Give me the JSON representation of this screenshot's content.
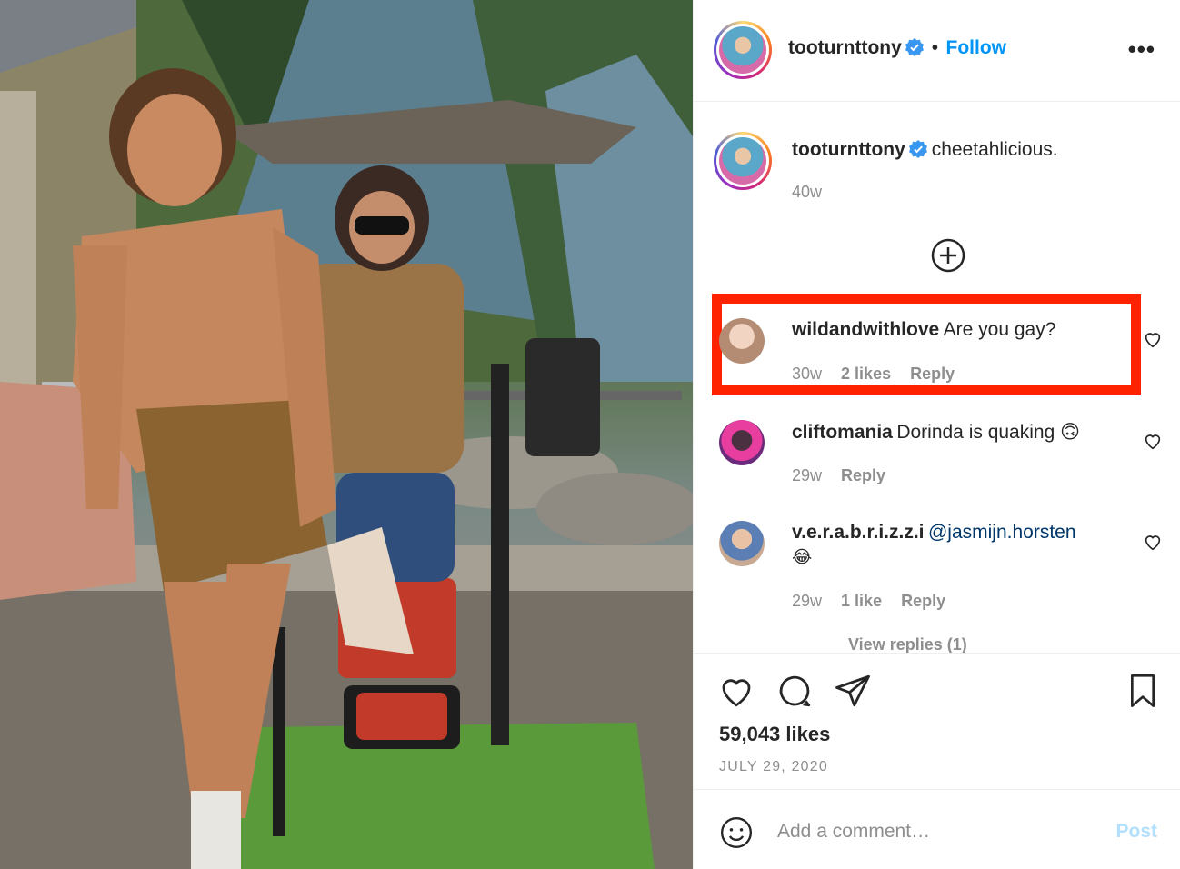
{
  "post": {
    "author": "tooturnttony",
    "follow_label": "Follow",
    "separator": "•",
    "more_label": "•••",
    "caption_user": "tooturnttony",
    "caption_text": "cheetahlicious.",
    "caption_time": "40w"
  },
  "comments": [
    {
      "user": "wildandwithlove",
      "text": "Are you gay?",
      "time": "30w",
      "likes": "2 likes",
      "reply": "Reply"
    },
    {
      "user": "cliftomania",
      "text": "Dorinda is quaking 🙃",
      "time": "29w",
      "likes": "",
      "reply": "Reply"
    },
    {
      "user": "v.e.r.a.b.r.i.z.z.i",
      "mention": "@jasmijn.horsten",
      "emoji": "😂",
      "time": "29w",
      "likes": "1 like",
      "reply": "Reply",
      "view_replies": "View replies (1)"
    }
  ],
  "actions": {
    "likes": "59,043 likes",
    "date": "JULY 29, 2020"
  },
  "add_comment": {
    "placeholder": "Add a comment…",
    "post_label": "Post"
  },
  "colors": {
    "accent": "#0095f6",
    "highlight": "#ff2200",
    "muted": "#8e8e8e"
  }
}
